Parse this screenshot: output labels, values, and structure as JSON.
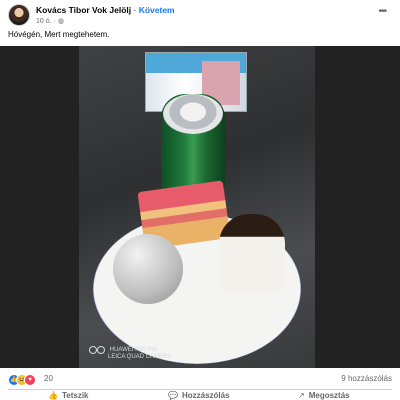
{
  "post": {
    "author": "Kovács Tibor Vok Jelölj",
    "follow_label": "Követem",
    "time": "10 ó.",
    "privacy_icon": "globe-icon",
    "separator": "·",
    "text": "Hóvégén, Mert megtehetem."
  },
  "photo": {
    "watermark_line1": "HUAWEI P30 Pro",
    "watermark_line2": "LEICA QUAD CAMERA"
  },
  "engagement": {
    "reaction_icons": [
      "like-reaction-icon",
      "haha-reaction-icon",
      "love-reaction-icon"
    ],
    "reaction_count": "20",
    "comments": "9 hozzászólás"
  },
  "actions": {
    "like": "Tetszik",
    "comment": "Hozzászólás",
    "share": "Megosztás"
  },
  "colors": {
    "accent": "#1877f2",
    "secondary_text": "#65676b"
  }
}
